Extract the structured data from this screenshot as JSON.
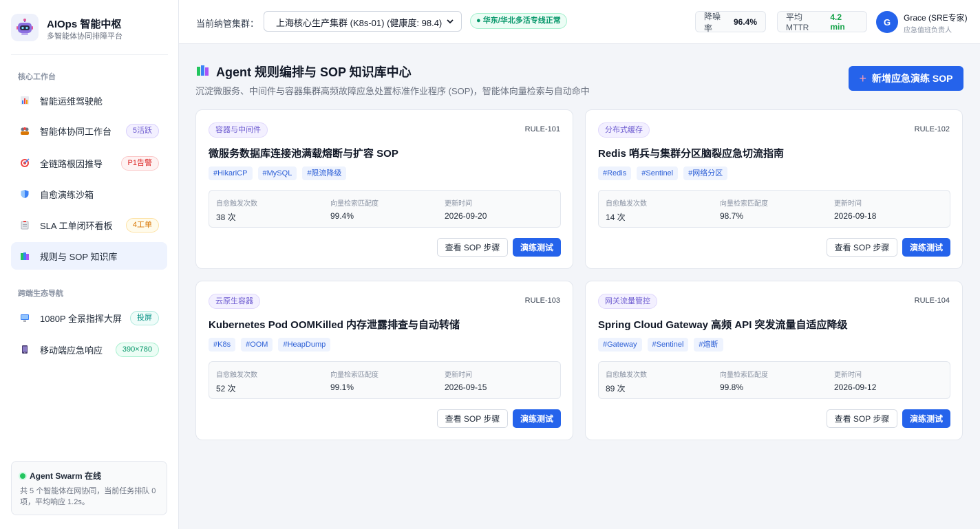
{
  "brand": {
    "title": "AIOps 智能中枢",
    "subtitle": "多智能体协同排障平台",
    "logo_icon": "robot-icon"
  },
  "sidebar": {
    "section_core": "核心工作台",
    "items": [
      {
        "label": "智能运维驾驶舱",
        "icon": "dashboard-icon",
        "badge": ""
      },
      {
        "label": "智能体协同工作台",
        "icon": "agents-icon",
        "badge": "5活跃"
      },
      {
        "label": "全链路根因推导",
        "icon": "target-icon",
        "badge": "P1告警"
      },
      {
        "label": "自愈演练沙箱",
        "icon": "shield-icon",
        "badge": ""
      },
      {
        "label": "SLA 工单闭环看板",
        "icon": "clipboard-icon",
        "badge": "4工单"
      },
      {
        "label": "规则与 SOP 知识库",
        "icon": "books-icon",
        "badge": "",
        "active": true
      }
    ],
    "section_cross": "跨端生态导航",
    "cross_items": [
      {
        "label": "1080P 全景指挥大屏",
        "icon": "monitor-icon",
        "badge": "投屏"
      },
      {
        "label": "移动端应急响应",
        "icon": "phone-icon",
        "badge": "390×780"
      }
    ],
    "swarm": {
      "title": "Agent Swarm 在线",
      "desc": "共 5 个智能体在网协同，当前任务排队 0 项，平均响应 1.2s。"
    }
  },
  "header": {
    "cluster_label": "当前纳管集群：",
    "cluster_value": "上海核心生产集群 (K8s-01) (健康度: 98.4)",
    "status": "华东/华北多活专线正常",
    "noise_label": "降噪率",
    "noise_value": "96.4%",
    "mttr_label": "平均MTTR",
    "mttr_value": "4.2 min",
    "user_initial": "G",
    "user_name": "Grace (SRE专家)",
    "user_role": "应急值班负责人"
  },
  "main": {
    "title": "Agent 规则编排与 SOP 知识库中心",
    "subtitle": "沉淀微服务、中间件与容器集群高频故障应急处置标准作业程序 (SOP)，智能体向量检索与自动命中",
    "new_button": "新增应急演练 SOP",
    "stat_labels": {
      "triggers": "自愈触发次数",
      "match": "向量检索匹配度",
      "updated": "更新时间"
    },
    "view_button": "查看 SOP 步骤",
    "test_button": "演练测试",
    "cards": [
      {
        "category": "容器与中间件",
        "id": "RULE-101",
        "title": "微服务数据库连接池满载熔断与扩容 SOP",
        "tags": [
          "#HikariCP",
          "#MySQL",
          "#限流降级"
        ],
        "triggers": "38 次",
        "match": "99.4%",
        "updated": "2026-09-20"
      },
      {
        "category": "分布式缓存",
        "id": "RULE-102",
        "title": "Redis 哨兵与集群分区脑裂应急切流指南",
        "tags": [
          "#Redis",
          "#Sentinel",
          "#网络分区"
        ],
        "triggers": "14 次",
        "match": "98.7%",
        "updated": "2026-09-18"
      },
      {
        "category": "云原生容器",
        "id": "RULE-103",
        "title": "Kubernetes Pod OOMKilled 内存泄露排查与自动转储",
        "tags": [
          "#K8s",
          "#OOM",
          "#HeapDump"
        ],
        "triggers": "52 次",
        "match": "99.1%",
        "updated": "2026-09-15"
      },
      {
        "category": "网关流量管控",
        "id": "RULE-104",
        "title": "Spring Cloud Gateway 高频 API 突发流量自适应降级",
        "tags": [
          "#Gateway",
          "#Sentinel",
          "#熔断"
        ],
        "triggers": "89 次",
        "match": "99.8%",
        "updated": "2026-09-12"
      }
    ]
  }
}
